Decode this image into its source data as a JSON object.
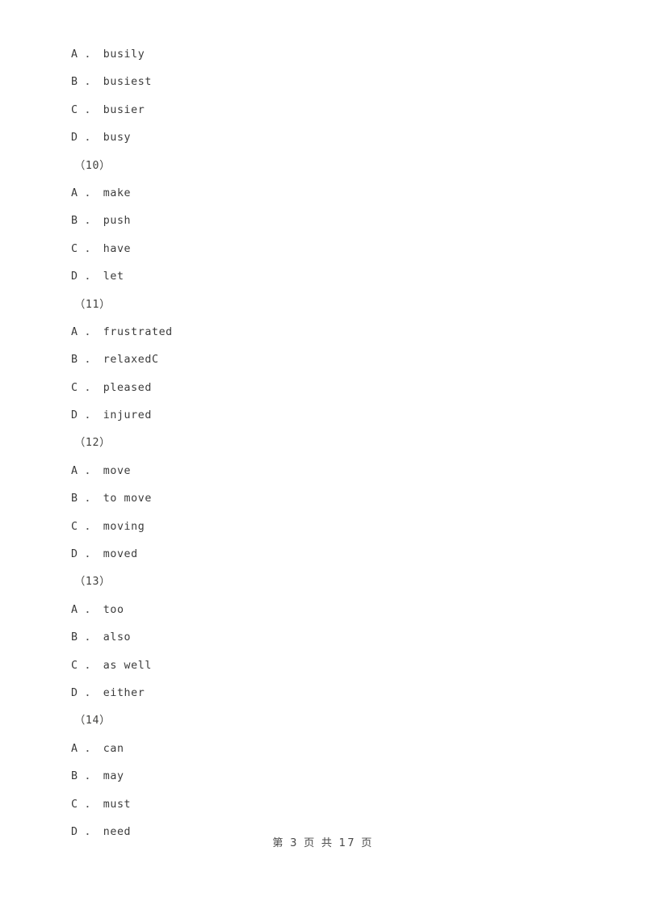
{
  "document": {
    "page_background": "#ffffff",
    "text_color": "#3c3c3c",
    "option_separator": "．"
  },
  "question_groups": [
    {
      "marker": "",
      "options": [
        {
          "letter": "A",
          "text": "busily"
        },
        {
          "letter": "B",
          "text": "busiest"
        },
        {
          "letter": "C",
          "text": "busier"
        },
        {
          "letter": "D",
          "text": "busy"
        }
      ]
    },
    {
      "marker": "（10）",
      "options": [
        {
          "letter": "A",
          "text": "make"
        },
        {
          "letter": "B",
          "text": "push"
        },
        {
          "letter": "C",
          "text": "have"
        },
        {
          "letter": "D",
          "text": "let"
        }
      ]
    },
    {
      "marker": "（11）",
      "options": [
        {
          "letter": "A",
          "text": "frustrated"
        },
        {
          "letter": "B",
          "text": "relaxedC"
        },
        {
          "letter": "C",
          "text": "pleased"
        },
        {
          "letter": "D",
          "text": "injured"
        }
      ]
    },
    {
      "marker": "（12）",
      "options": [
        {
          "letter": "A",
          "text": "move"
        },
        {
          "letter": "B",
          "text": "to move"
        },
        {
          "letter": "C",
          "text": "moving"
        },
        {
          "letter": "D",
          "text": "moved"
        }
      ]
    },
    {
      "marker": "（13）",
      "options": [
        {
          "letter": "A",
          "text": "too"
        },
        {
          "letter": "B",
          "text": "also"
        },
        {
          "letter": "C",
          "text": "as well"
        },
        {
          "letter": "D",
          "text": "either"
        }
      ]
    },
    {
      "marker": "（14）",
      "options": [
        {
          "letter": "A",
          "text": "can"
        },
        {
          "letter": "B",
          "text": "may"
        },
        {
          "letter": "C",
          "text": "must"
        },
        {
          "letter": "D",
          "text": "need"
        }
      ]
    }
  ],
  "footer": {
    "text": "第 3 页 共 17 页",
    "current_page": "3",
    "total_pages": "17"
  }
}
